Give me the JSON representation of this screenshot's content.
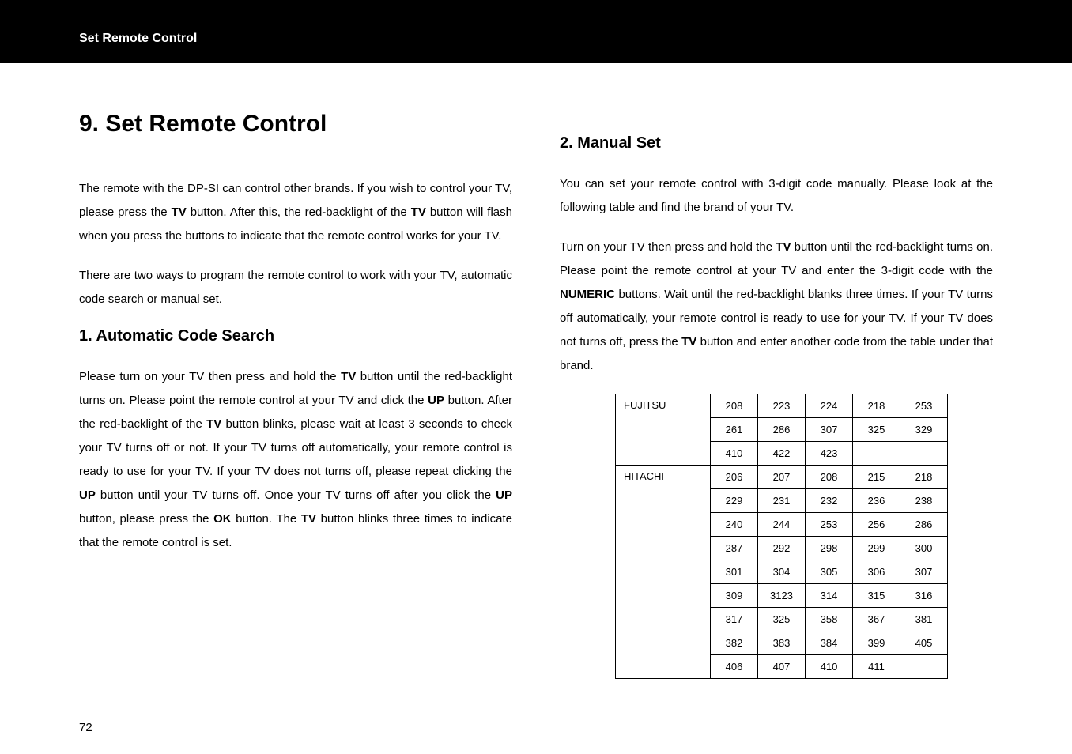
{
  "header": {
    "title": "Set Remote Control"
  },
  "page_number": "72",
  "main_title": "9. Set Remote Control",
  "intro_para": "The remote with the DP-SI can control other brands. If you wish to control your TV, please press the <b>TV</b> button. After this, the red-backlight of the <b>TV</b> button will flash when you press the buttons to indicate that the remote control works for your TV.",
  "intro_para2": "There are two ways to program the remote control to work with your TV, automatic code search or manual set.",
  "section1": {
    "heading": "1. Automatic Code Search",
    "body": "Please turn on your TV then press and hold the <b>TV</b> button until the red-backlight turns on. Please point the remote control at your TV and click the <b>UP</b> button. After the red-backlight of the <b>TV</b> button blinks, please wait at least 3 seconds to check your TV turns off or not. If your TV turns off automatically, your remote control is ready to use for your TV. If your TV does not turns off, please repeat clicking the <b>UP</b> button until your TV turns off. Once your TV turns off after you click the <b>UP</b> button, please press the <b>OK</b> button. The <b>TV</b> button blinks three times to indicate that the remote control is set."
  },
  "section2": {
    "heading": "2. Manual Set",
    "body1": "You can set your remote control with 3-digit code manually. Please look at the following table and find the brand of your TV.",
    "body2": "Turn on your TV then press and hold the <b>TV</b> button until the red-backlight turns on. Please point the remote control at your TV and enter the 3-digit code with the <b>NUMERIC</b> buttons. Wait until the red-backlight blanks three times. If your TV turns off automatically, your remote control is ready to use for your TV. If your TV does not turns off, press the <b>TV</b> button and enter another code from the table under that brand."
  },
  "table": {
    "brands": [
      {
        "name": "FUJITSU",
        "rows": [
          [
            "208",
            "223",
            "224",
            "218",
            "253"
          ],
          [
            "261",
            "286",
            "307",
            "325",
            "329"
          ],
          [
            "410",
            "422",
            "423",
            "",
            ""
          ]
        ]
      },
      {
        "name": "HITACHI",
        "rows": [
          [
            "206",
            "207",
            "208",
            "215",
            "218"
          ],
          [
            "229",
            "231",
            "232",
            "236",
            "238"
          ],
          [
            "240",
            "244",
            "253",
            "256",
            "286"
          ],
          [
            "287",
            "292",
            "298",
            "299",
            "300"
          ],
          [
            "301",
            "304",
            "305",
            "306",
            "307"
          ],
          [
            "309",
            "3123",
            "314",
            "315",
            "316"
          ],
          [
            "317",
            "325",
            "358",
            "367",
            "381"
          ],
          [
            "382",
            "383",
            "384",
            "399",
            "405"
          ],
          [
            "406",
            "407",
            "410",
            "411",
            ""
          ]
        ]
      }
    ]
  }
}
